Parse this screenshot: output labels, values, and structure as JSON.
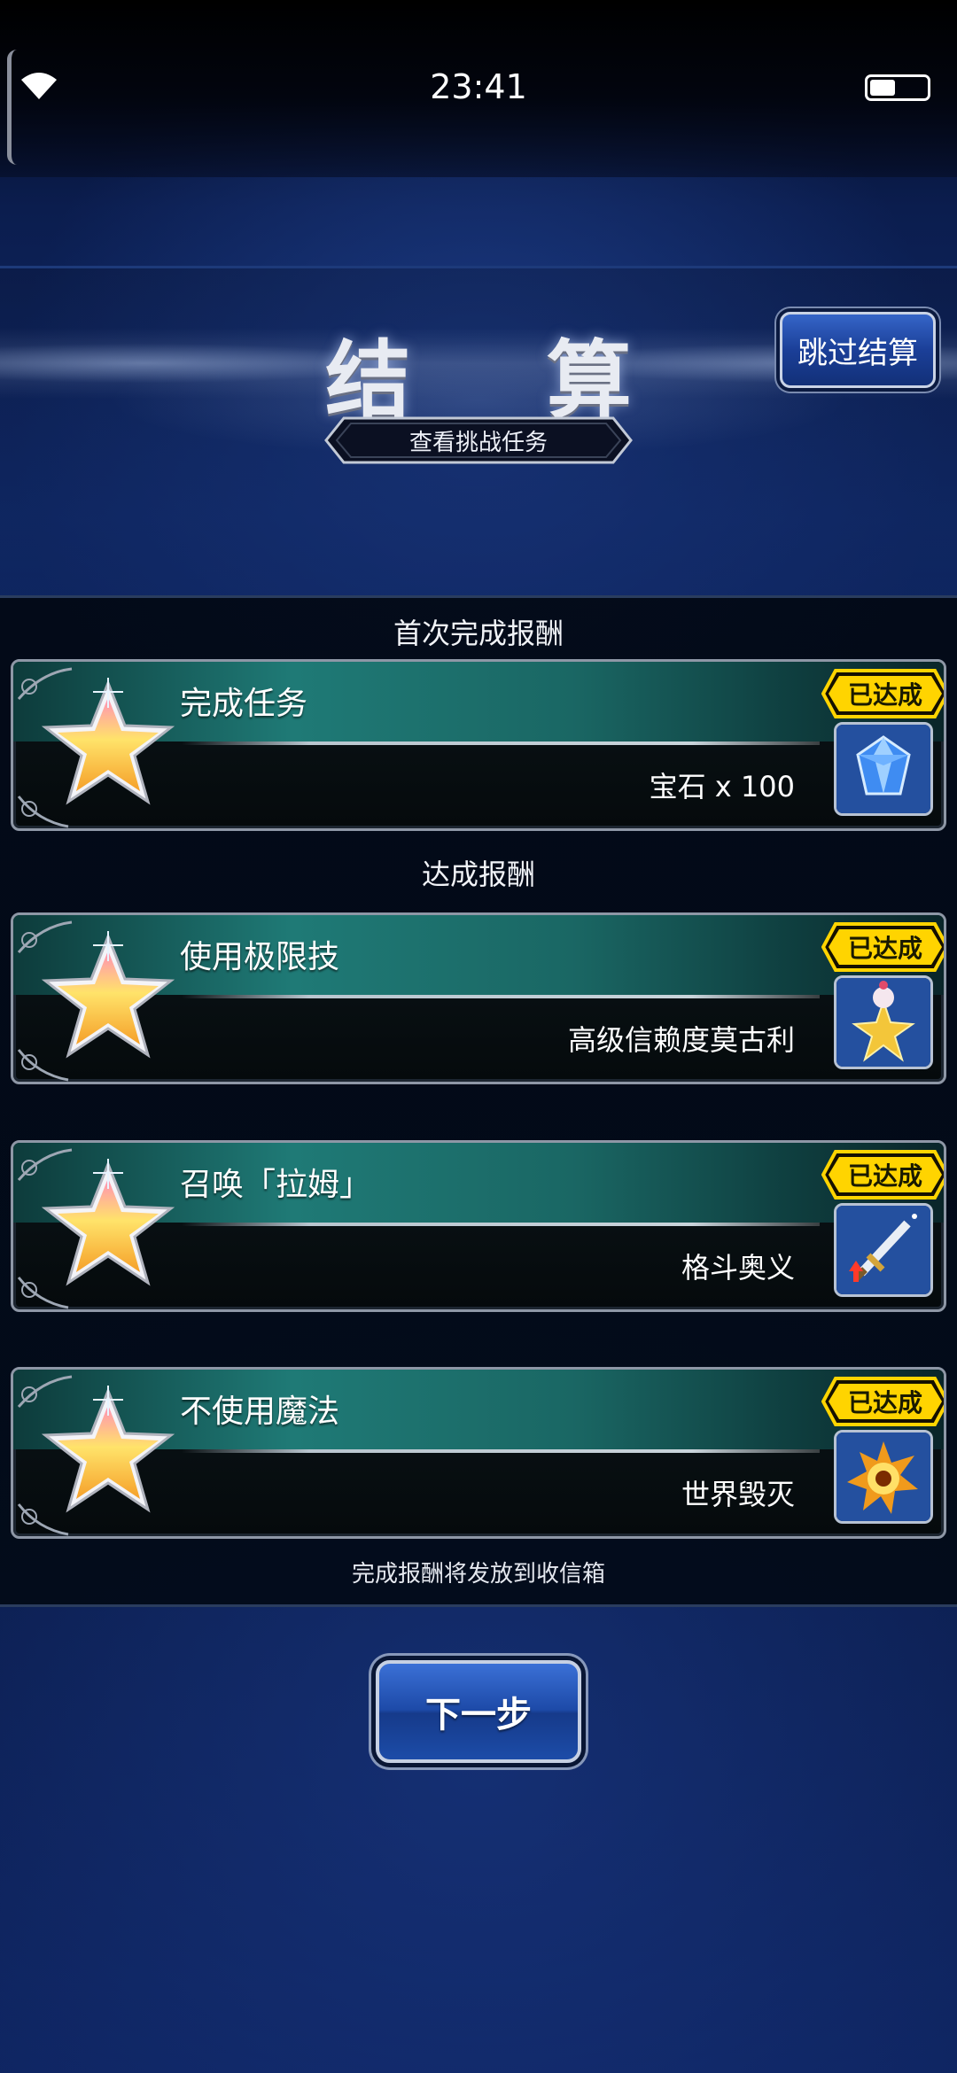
{
  "status_bar": {
    "time": "23:41",
    "battery_level": 0.45
  },
  "header": {
    "title": "结 算",
    "skip_button_label": "跳过结算",
    "challenge_tab_label": "查看挑战任务"
  },
  "sections": {
    "first_clear_label": "首次完成报酬",
    "achievement_label": "达成报酬",
    "footer_note": "完成报酬将发放到收信箱"
  },
  "missions": [
    {
      "title": "完成任务",
      "reward": "宝石 x 100",
      "badge": "已达成",
      "reward_icon": "blue-gem-icon"
    },
    {
      "title": "使用极限技",
      "reward": "高级信赖度莫古利",
      "badge": "已达成",
      "reward_icon": "moogle-star-icon"
    },
    {
      "title": "召唤「拉姆」",
      "reward": "格斗奥义",
      "badge": "已达成",
      "reward_icon": "sword-upgrade-icon"
    },
    {
      "title": "不使用魔法",
      "reward": "世界毁灭",
      "badge": "已达成",
      "reward_icon": "explosion-icon"
    }
  ],
  "next_button_label": "下一步",
  "colors": {
    "accent_gold": "#ffd400",
    "teal": "#1f7a76",
    "button_blue": "#1d4aa8"
  }
}
